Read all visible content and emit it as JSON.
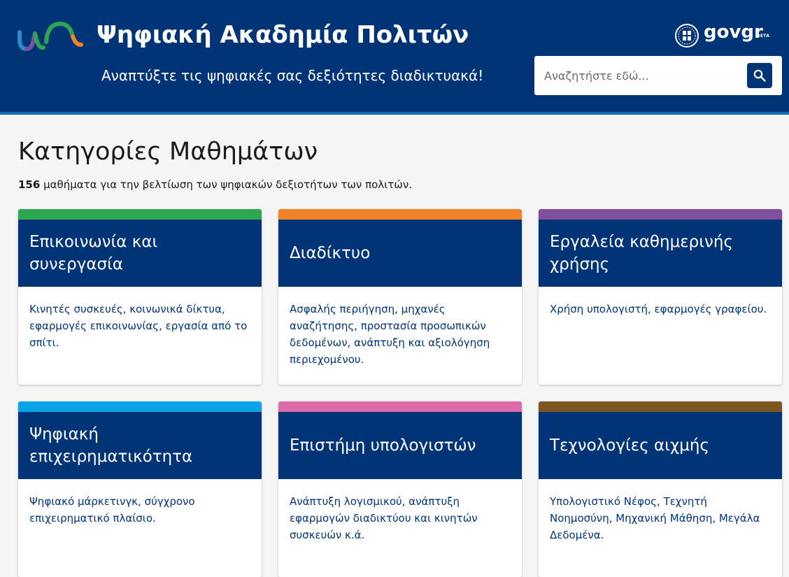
{
  "header": {
    "site_title": "Ψηφιακή Ακαδημία Πολιτών",
    "tagline": "Αναπτύξτε τις ψηφιακές σας δεξιότητες διαδικτυακά!",
    "logo_icon": "academy-logo-icon",
    "govgr": {
      "gov": "gov",
      "gr": "gr",
      "beta": "BETA"
    },
    "search": {
      "placeholder": "Αναζητήστε εδώ...",
      "value": "",
      "button_icon": "search-icon"
    },
    "colors": {
      "primary": "#003476",
      "accent_line": "#0d6db3"
    }
  },
  "main": {
    "heading": "Κατηγορίες Μαθημάτων",
    "count": "156",
    "count_text": " μαθήματα για την βελτίωση των ψηφιακών δεξιοτήτων των πολιτών."
  },
  "categories": [
    {
      "title": "Επικοινωνία και συνεργασία",
      "description": "Κινητές συσκευές, κοινωνικά δίκτυα, εφαρμογές επικοινωνίας, εργασία από το σπίτι.",
      "color": "#2ea550"
    },
    {
      "title": "Διαδίκτυο",
      "description": "Ασφαλής περιήγηση, μηχανές αναζήτησης, προστασία προσωπικών δεδομένων, ανάπτυξη και αξιολόγηση περιεχομένου.",
      "color": "#f08327"
    },
    {
      "title": "Εργαλεία καθημερινής χρήσης",
      "description": "Χρήση υπολογιστή, εφαρμογές γραφείου.",
      "color": "#7f4f9e"
    },
    {
      "title": "Ψηφιακή επιχειρηματικότητα",
      "description": "Ψηφιακό μάρκετινγκ, σύγχρονο επιχειρηματικό πλαίσιο.",
      "color": "#09a4e6"
    },
    {
      "title": "Επιστήμη υπολογιστών",
      "description": "Ανάπτυξη λογισμικού, ανάπτυξη εφαρμογών διαδικτύου και κινητών συσκευών κ.ά.",
      "color": "#db6aa6"
    },
    {
      "title": "Τεχνολογίες αιχμής",
      "description": "Υπολογιστικό Νέφος, Τεχνητή Νοημοσύνη,  Μηχανική Μάθηση, Μεγάλα Δεδομένα.",
      "color": "#7e551f"
    }
  ]
}
